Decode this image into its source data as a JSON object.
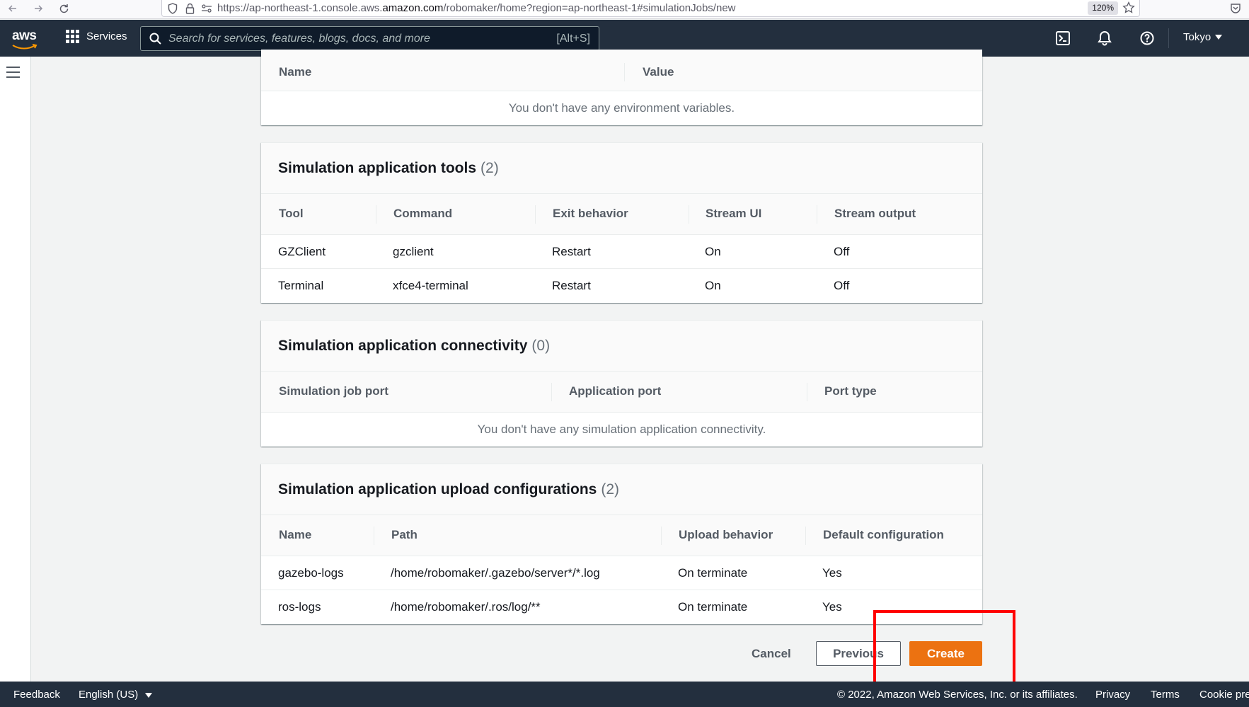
{
  "browser": {
    "url_prefix": "https://ap-northeast-1.console.aws.",
    "url_domain": "amazon.com",
    "url_suffix": "/robomaker/home?region=ap-northeast-1#simulationJobs/new",
    "zoom": "120%"
  },
  "nav": {
    "logo": "aws",
    "services_label": "Services",
    "search_placeholder": "Search for services, features, blogs, docs, and more",
    "search_shortcut": "[Alt+S]",
    "region": "Tokyo"
  },
  "env_vars": {
    "columns": [
      "Name",
      "Value"
    ],
    "empty_message": "You don't have any environment variables."
  },
  "tools": {
    "title": "Simulation application tools",
    "count": "(2)",
    "columns": [
      "Tool",
      "Command",
      "Exit behavior",
      "Stream UI",
      "Stream output"
    ],
    "rows": [
      [
        "GZClient",
        "gzclient",
        "Restart",
        "On",
        "Off"
      ],
      [
        "Terminal",
        "xfce4-terminal",
        "Restart",
        "On",
        "Off"
      ]
    ]
  },
  "connectivity": {
    "title": "Simulation application connectivity",
    "count": "(0)",
    "columns": [
      "Simulation job port",
      "Application port",
      "Port type"
    ],
    "empty_message": "You don't have any simulation application connectivity."
  },
  "uploads": {
    "title": "Simulation application upload configurations",
    "count": "(2)",
    "columns": [
      "Name",
      "Path",
      "Upload behavior",
      "Default configuration"
    ],
    "rows": [
      [
        "gazebo-logs",
        "/home/robomaker/.gazebo/server*/*.log",
        "On terminate",
        "Yes"
      ],
      [
        "ros-logs",
        "/home/robomaker/.ros/log/**",
        "On terminate",
        "Yes"
      ]
    ]
  },
  "actions": {
    "cancel": "Cancel",
    "previous": "Previous",
    "create": "Create"
  },
  "footer": {
    "feedback": "Feedback",
    "language": "English (US)",
    "copyright": "© 2022, Amazon Web Services, Inc. or its affiliates.",
    "privacy": "Privacy",
    "terms": "Terms",
    "cookie": "Cookie pre"
  },
  "colors": {
    "nav_bg": "#232f3e",
    "primary": "#ec7211",
    "highlight": "#ff0000"
  }
}
